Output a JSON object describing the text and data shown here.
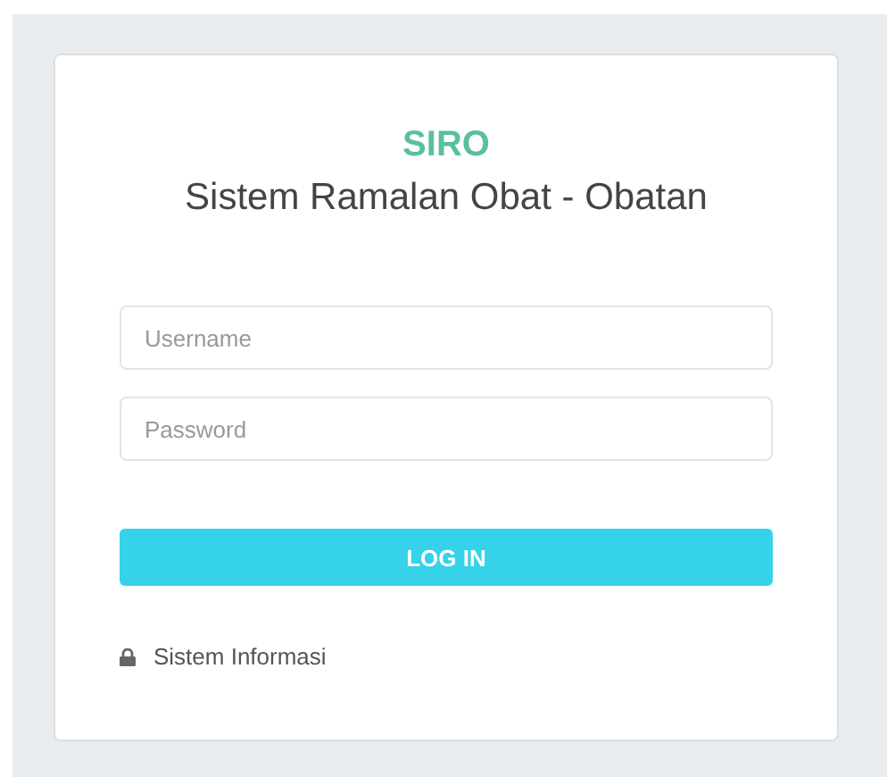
{
  "brand": "SIRO",
  "subtitle": "Sistem Ramalan Obat - Obatan",
  "fields": [
    {
      "placeholder": "Username"
    },
    {
      "placeholder": "Password"
    }
  ],
  "button": "LOG IN",
  "footer": "Sistem Informasi"
}
